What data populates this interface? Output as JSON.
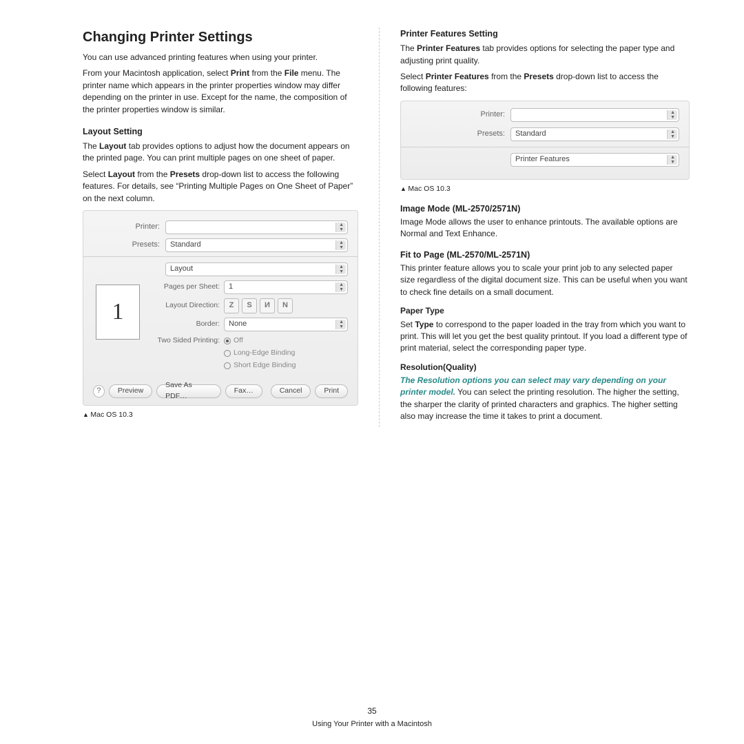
{
  "left": {
    "title": "Changing Printer Settings",
    "intro": "You can use advanced printing features when using your printer.",
    "intro2_pre": "From your Macintosh application, select ",
    "intro2_b1": "Print",
    "intro2_mid": " from the ",
    "intro2_b2": "File",
    "intro2_post": " menu. The printer name which appears in the printer properties window may differ depending on the printer in use. Except for the name, the composition of the printer properties window is similar.",
    "layout_head": "Layout Setting",
    "layout_p1_pre": "The ",
    "layout_p1_b1": "Layout",
    "layout_p1_post": " tab provides options to adjust how the document appears on the printed page. You can print multiple pages on one sheet of paper.",
    "layout_p2_pre": "Select ",
    "layout_p2_b1": "Layout",
    "layout_p2_mid": " from the ",
    "layout_p2_b2": "Presets",
    "layout_p2_post": " drop-down list to access the following features. For details, see “Printing Multiple Pages on One Sheet of Paper” on the next column.",
    "caption": "Mac OS 10.3"
  },
  "dlg": {
    "printer_label": "Printer:",
    "presets_label": "Presets:",
    "presets_value": "Standard",
    "section_value": "Layout",
    "pps_label": "Pages per Sheet:",
    "pps_value": "1",
    "dir_label": "Layout Direction:",
    "dir1": "Z",
    "dir2": "S",
    "dir3": "И",
    "dir4": "N",
    "border_label": "Border:",
    "border_value": "None",
    "two_label": "Two Sided Printing:",
    "two_off": "Off",
    "two_long": "Long-Edge Binding",
    "two_short": "Short Edge Binding",
    "preview_num": "1",
    "help": "?",
    "preview": "Preview",
    "savepdf": "Save As PDF…",
    "fax": "Fax…",
    "cancel": "Cancel",
    "print": "Print"
  },
  "right": {
    "pf_head": "Printer Features Setting",
    "pf_p1_pre": "The ",
    "pf_p1_b": "Printer Features",
    "pf_p1_post": " tab provides options for selecting the paper type and adjusting print quality.",
    "pf_p2_pre": "Select ",
    "pf_p2_b1": "Printer Features",
    "pf_p2_mid": " from the ",
    "pf_p2_b2": "Presets",
    "pf_p2_post": " drop-down list to access the following features:",
    "caption": "Mac OS 10.3",
    "im_head": "Image Mode (ML-2570/2571N)",
    "im_body": "Image Mode allows the user to enhance printouts. The available options are Normal and Text Enhance.",
    "fit_head": "Fit to Page (ML-2570/ML-2571N)",
    "fit_body": "This printer feature allows you to scale your print job to any selected paper size regardless of the digital document size. This can be useful when you want to check fine details on a small document.",
    "pt_head": "Paper Type",
    "pt_pre": "Set ",
    "pt_b": "Type",
    "pt_post": " to correspond to the paper loaded in the tray from which you want to print. This will let you get the best quality printout. If you load a different type of print material, select the corresponding paper type.",
    "res_head": "Resolution(Quality)",
    "res_italic": "The Resolution options you can select may vary depending on your printer model.",
    "res_post": " You can select the printing resolution. The higher the setting, the sharper the clarity of printed characters and graphics. The higher setting also may increase the time it takes to print a document."
  },
  "dlg2": {
    "printer_label": "Printer:",
    "presets_label": "Presets:",
    "presets_value": "Standard",
    "section_value": "Printer Features"
  },
  "footer": {
    "page": "35",
    "chapter": "Using Your Printer with a Macintosh"
  }
}
